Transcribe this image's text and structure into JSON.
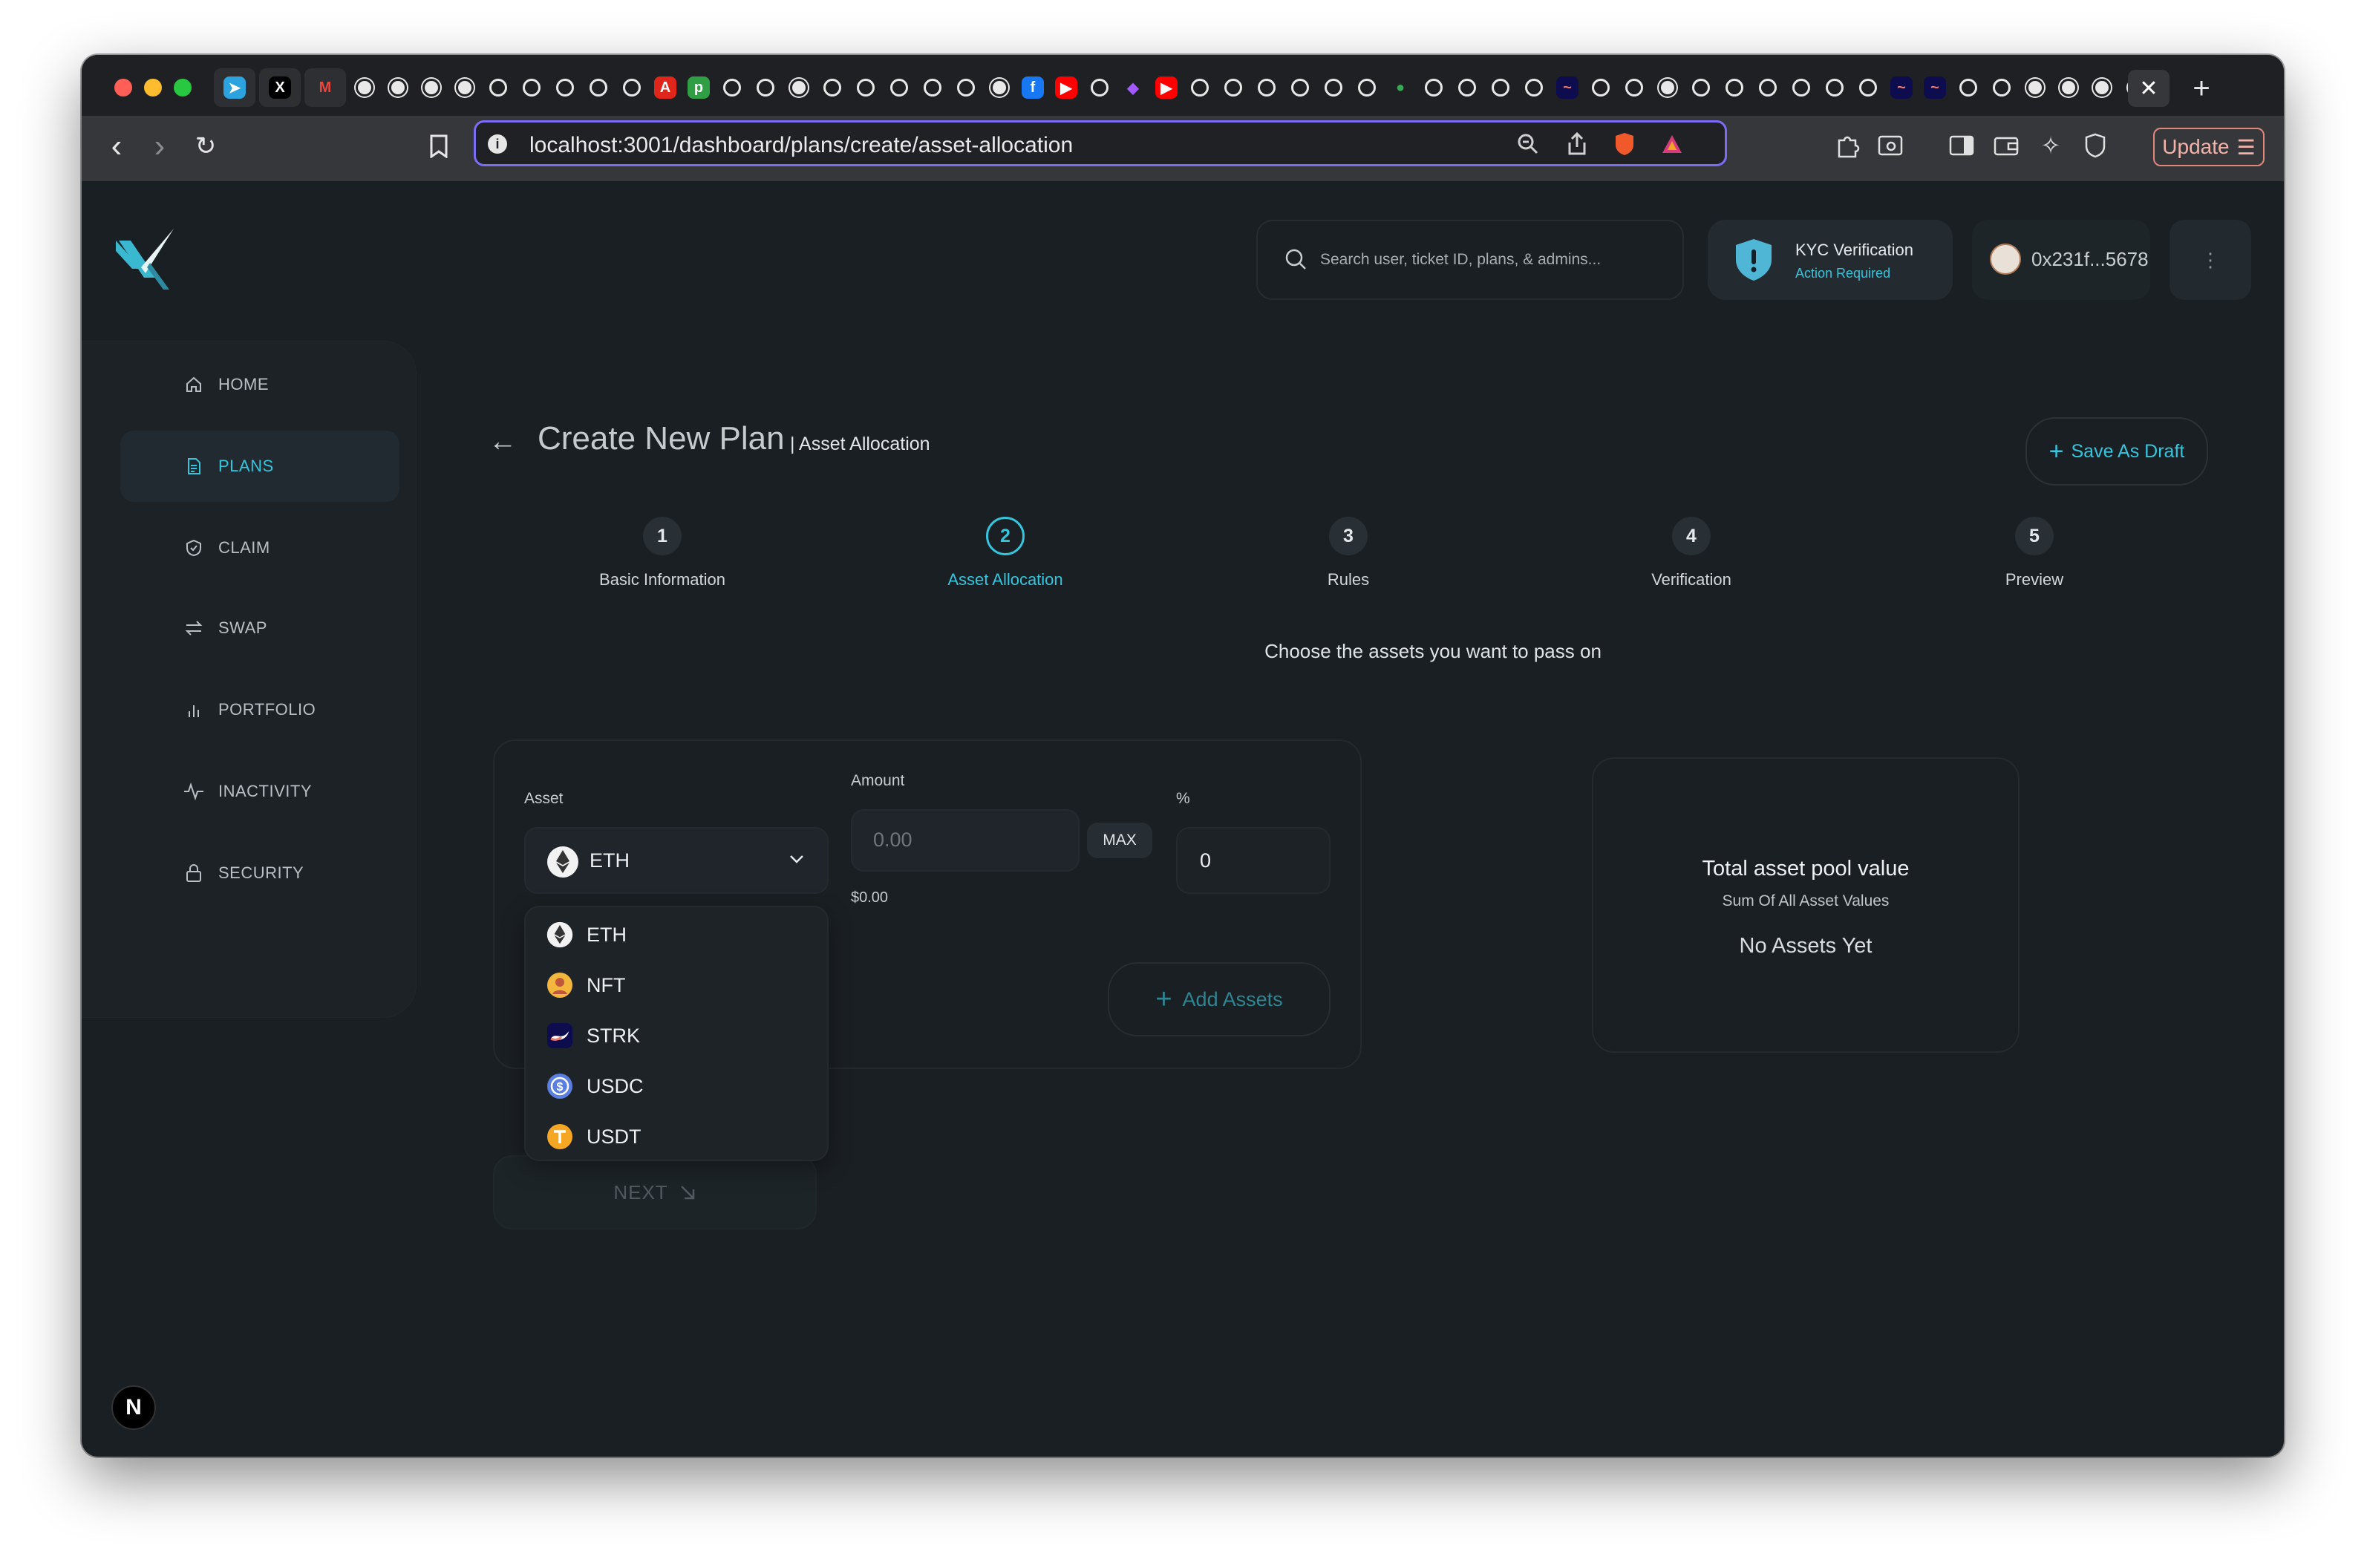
{
  "browser": {
    "url": "localhost:3001/dashboard/plans/create/asset-allocation",
    "update_label": "Update",
    "tab_icons": [
      "telegram-icon",
      "x-icon",
      "gmail-icon",
      "github-icon",
      "github-icon",
      "github-icon",
      "github-icon",
      "app-icon",
      "app-icon",
      "app-icon",
      "app-icon",
      "app-icon",
      "adobe-icon",
      "pdf-icon",
      "app-icon",
      "app-icon",
      "github-icon",
      "app-icon",
      "app-icon",
      "app-icon",
      "app-icon",
      "app-icon",
      "github-icon",
      "facebook-icon",
      "youtube-icon",
      "app-icon",
      "figma-icon",
      "youtube-icon",
      "app-icon",
      "app-icon",
      "app-icon",
      "app-icon",
      "app-icon",
      "app-icon",
      "maps-icon",
      "app-icon",
      "app-icon",
      "app-icon",
      "app-icon",
      "starknet-icon",
      "app-icon",
      "app-icon",
      "github-icon",
      "app-icon",
      "app-icon",
      "app-icon",
      "app-icon",
      "app-icon",
      "app-icon",
      "starknet-icon",
      "starknet-icon",
      "app-icon",
      "app-icon",
      "github-icon",
      "github-icon",
      "github-icon",
      "app-icon"
    ]
  },
  "header": {
    "search_placeholder": "Search user, ticket ID, plans, & admins...",
    "kyc_title": "KYC Verification",
    "kyc_status": "Action Required",
    "wallet_address": "0x231f...5678",
    "more_label": "⋮"
  },
  "sidebar": {
    "items": [
      {
        "label": "HOME",
        "icon": "home-icon"
      },
      {
        "label": "PLANS",
        "icon": "document-icon"
      },
      {
        "label": "CLAIM",
        "icon": "shield-check-icon"
      },
      {
        "label": "SWAP",
        "icon": "swap-icon"
      },
      {
        "label": "PORTFOLIO",
        "icon": "bar-chart-icon"
      },
      {
        "label": "INACTIVITY",
        "icon": "activity-icon"
      },
      {
        "label": "SECURITY",
        "icon": "lock-icon"
      }
    ],
    "active_index": 1
  },
  "page": {
    "title": "Create New Plan",
    "subtitle": "| Asset Allocation",
    "save_draft_label": "Save As Draft",
    "steps": [
      {
        "number": "1",
        "label": "Basic Information"
      },
      {
        "number": "2",
        "label": "Asset Allocation"
      },
      {
        "number": "3",
        "label": "Rules"
      },
      {
        "number": "4",
        "label": "Verification"
      },
      {
        "number": "5",
        "label": "Preview"
      }
    ],
    "active_step": 2,
    "instruction": "Choose the assets you want to pass on"
  },
  "allocation": {
    "asset_label": "Asset",
    "selected_asset": "ETH",
    "amount_label": "Amount",
    "amount_placeholder": "0.00",
    "max_label": "MAX",
    "usd_value": "$0.00",
    "percent_label": "%",
    "percent_value": "0",
    "add_assets_label": "Add Assets",
    "options": [
      "ETH",
      "NFT",
      "STRK",
      "USDC",
      "USDT"
    ]
  },
  "pool": {
    "title": "Total asset pool value",
    "subtitle": "Sum Of All Asset Values",
    "empty_text": "No Assets Yet"
  },
  "next_label": "NEXT",
  "dev_badge": "N",
  "colors": {
    "accent": "#35c5dd",
    "background": "#1a1f23"
  }
}
